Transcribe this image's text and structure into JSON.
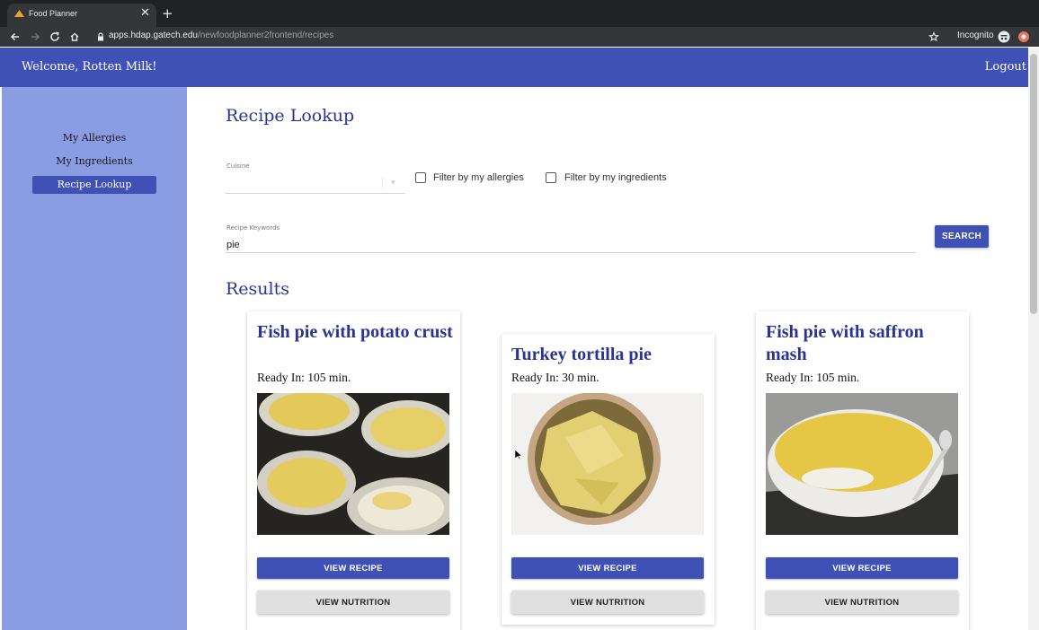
{
  "browser": {
    "tab_title": "Food Planner",
    "tab_close": "✕",
    "new_tab": "+",
    "url_host": "apps.hdap.gatech.edu",
    "url_path": "/newfoodplanner2frontend/recipes",
    "incognito_label": "Incognito"
  },
  "header": {
    "welcome": "Welcome, Rotten Milk!",
    "logout": "Logout"
  },
  "sidebar": {
    "items": [
      {
        "label": "My Allergies",
        "active": false
      },
      {
        "label": "My Ingredients",
        "active": false
      },
      {
        "label": "Recipe Lookup",
        "active": true
      }
    ]
  },
  "main": {
    "page_title": "Recipe Lookup",
    "cuisine_label": "Cuisine",
    "cuisine_value": "",
    "filter_allergies_label": "Filter by my allergies",
    "filter_ingredients_label": "Filter by my ingredients",
    "keywords_label": "Recipe Keywords",
    "keywords_value": "pie",
    "search_label": "SEARCH",
    "results_title": "Results"
  },
  "results": [
    {
      "title": "Fish pie with potato crust",
      "ready": "Ready In: 105 min.",
      "view_recipe": "VIEW RECIPE",
      "view_nutrition": "VIEW NUTRITION"
    },
    {
      "title": "Turkey tortilla pie",
      "ready": "Ready In: 30 min.",
      "view_recipe": "VIEW RECIPE",
      "view_nutrition": "VIEW NUTRITION"
    },
    {
      "title": "Fish pie with saffron mash",
      "ready": "Ready In: 105 min.",
      "view_recipe": "VIEW RECIPE",
      "view_nutrition": "VIEW NUTRITION"
    }
  ],
  "colors": {
    "primary": "#3f51b5",
    "sidebar": "#8a9de2",
    "title": "#283593"
  }
}
